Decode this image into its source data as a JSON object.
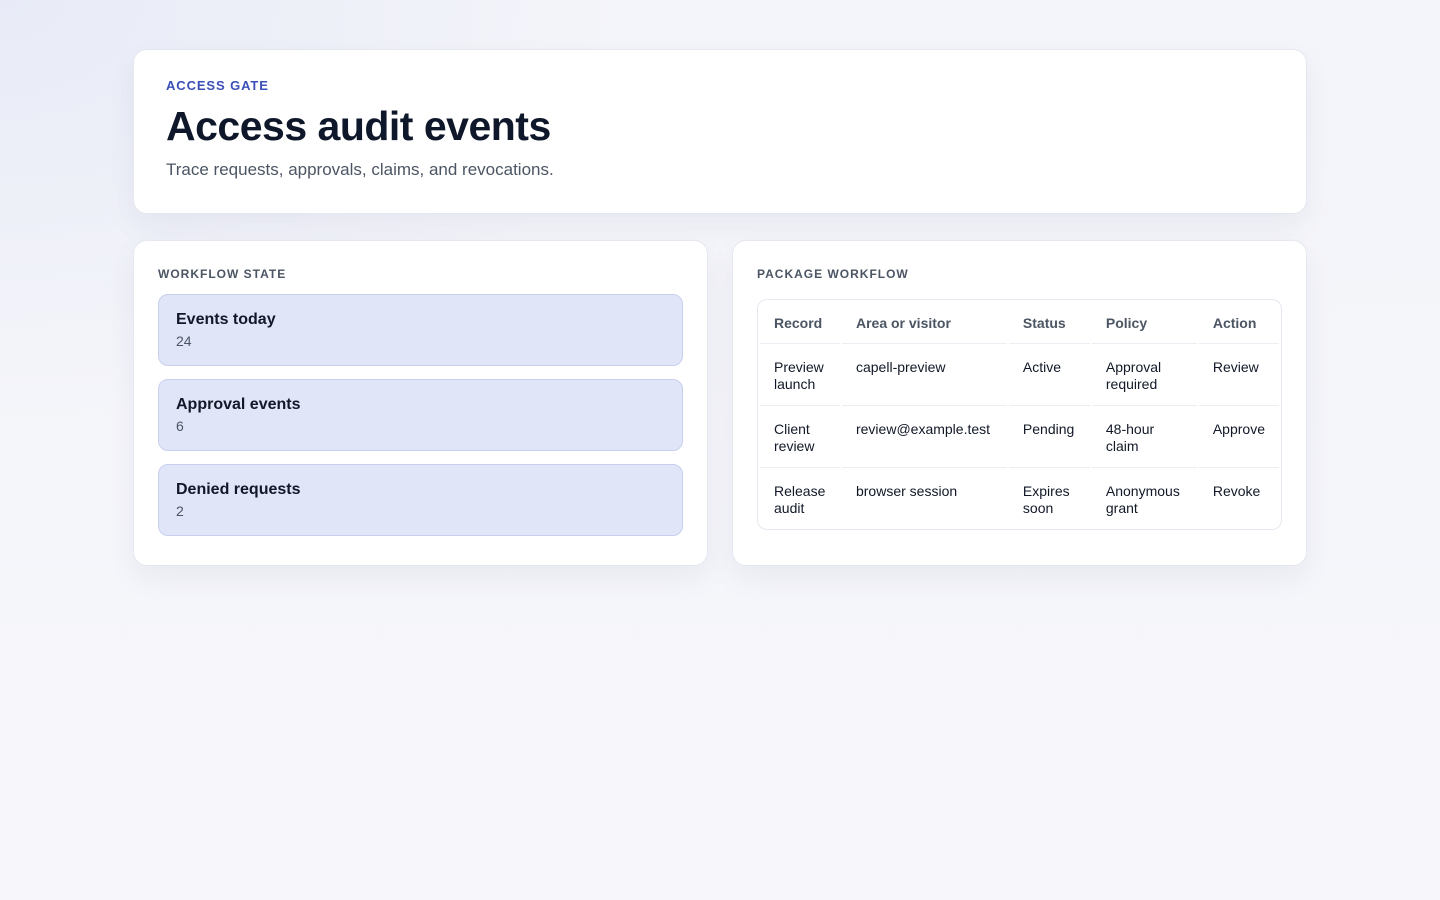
{
  "header": {
    "eyebrow": "ACCESS GATE",
    "title": "Access audit events",
    "subtitle": "Trace requests, approvals, claims, and revocations."
  },
  "workflow_state": {
    "label": "WORKFLOW STATE",
    "stats": [
      {
        "label": "Events today",
        "value": "24"
      },
      {
        "label": "Approval events",
        "value": "6"
      },
      {
        "label": "Denied requests",
        "value": "2"
      }
    ]
  },
  "package_workflow": {
    "label": "PACKAGE WORKFLOW",
    "columns": [
      "Record",
      "Area or visitor",
      "Status",
      "Policy",
      "Action"
    ],
    "rows": [
      {
        "record": "Preview launch",
        "area": "capell-preview",
        "status": "Active",
        "policy": "Approval required",
        "action": "Review"
      },
      {
        "record": "Client review",
        "area": "review@example.test",
        "status": "Pending",
        "policy": "48-hour claim",
        "action": "Approve"
      },
      {
        "record": "Release audit",
        "area": "browser session",
        "status": "Expires soon",
        "policy": "Anonymous grant",
        "action": "Revoke"
      }
    ]
  }
}
